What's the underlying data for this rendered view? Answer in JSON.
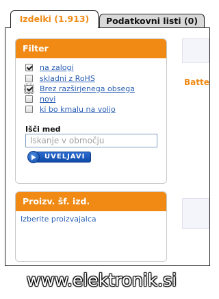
{
  "tabs": [
    {
      "label": "Izdelki (1.913)",
      "active": true
    },
    {
      "label": "Podatkovni listi (0)",
      "active": false
    }
  ],
  "filter": {
    "title": "Filter",
    "options": [
      {
        "label": "na zalogi",
        "checked": true
      },
      {
        "label": "skladni z RoHS",
        "checked": false
      },
      {
        "label": "Brez razširjenega obsega",
        "checked": true
      },
      {
        "label": "novi",
        "checked": false
      },
      {
        "label": "ki bo kmalu na voljo",
        "checked": false
      }
    ],
    "search_label": "Išči med",
    "search_placeholder": "Iskanje v območju",
    "apply_label": "UVELJAVI"
  },
  "manufacturer": {
    "title": "Proizv. šf. izd.",
    "link": "Izberite proizvajalca"
  },
  "right_panel": {
    "text": "Batte"
  },
  "watermark": "www.elektronik.si",
  "colors": {
    "accent": "#f08a14",
    "link": "#2a5fb4",
    "button": "#0f4aa8"
  }
}
